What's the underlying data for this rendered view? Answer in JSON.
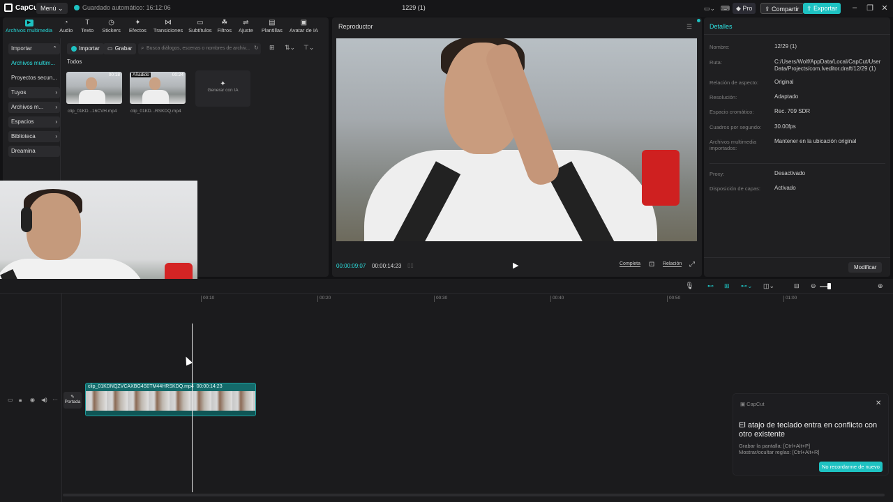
{
  "titlebar": {
    "brand": "CapCut",
    "menu": "Menú",
    "autosave": "Guardado automático: 16:12:06",
    "project_title": "1229 (1)",
    "pro": "Pro",
    "share": "Compartir",
    "export": "Exportar",
    "accent": "#1ec2c2"
  },
  "toolbar": {
    "items": [
      {
        "label": "Archivos multimedia",
        "icon": "media-icon"
      },
      {
        "label": "Audio",
        "icon": "audio-icon"
      },
      {
        "label": "Texto",
        "icon": "text-icon"
      },
      {
        "label": "Stickers",
        "icon": "sticker-icon"
      },
      {
        "label": "Efectos",
        "icon": "effects-icon"
      },
      {
        "label": "Transiciones",
        "icon": "transitions-icon"
      },
      {
        "label": "Subtítulos",
        "icon": "subtitles-icon"
      },
      {
        "label": "Filtros",
        "icon": "filters-icon"
      },
      {
        "label": "Ajuste",
        "icon": "adjust-icon"
      },
      {
        "label": "Plantillas",
        "icon": "templates-icon"
      },
      {
        "label": "Avatar de IA",
        "icon": "avatar-icon"
      }
    ]
  },
  "sidebar": {
    "items": [
      {
        "label": "Importar"
      },
      {
        "label": "Archivos multim..."
      },
      {
        "label": "Proyectos secun..."
      },
      {
        "label": "Tuyos"
      },
      {
        "label": "Archivos m..."
      },
      {
        "label": "Espacios"
      },
      {
        "label": "Biblioteca"
      },
      {
        "label": "Dreamina"
      }
    ]
  },
  "media": {
    "import": "Importar",
    "record": "Grabar",
    "search_placeholder": "Busca diálogos, escenas o nombres de archiv...",
    "section": "Todos",
    "clips": [
      {
        "name": "clip_01KD...16CVH.mp4",
        "duration": "00:18",
        "tag": ""
      },
      {
        "name": "clip_01KD...RSKDQ.mp4",
        "duration": "00:24",
        "tag": "Añadido"
      }
    ],
    "generate_ai": "Generar con IA"
  },
  "player": {
    "title": "Reproductor",
    "current_time": "00:00:09:07",
    "total_time": "00:00:14:23",
    "full": "Completa",
    "ratio": "Relación"
  },
  "details": {
    "title": "Detalles",
    "rows": [
      {
        "label": "Nombre:",
        "value": "12/29 (1)"
      },
      {
        "label": "Ruta:",
        "value": "C:/Users/Wolf/AppData/Local/CapCut/User Data/Projects/com.lveditor.draft/12/29 (1)"
      },
      {
        "label": "Relación de aspecto:",
        "value": "Original"
      },
      {
        "label": "Resolución:",
        "value": "Adaptado"
      },
      {
        "label": "Espacio cromático:",
        "value": "Rec. 709 SDR"
      },
      {
        "label": "Cuadros por segundo:",
        "value": "30.00fps"
      },
      {
        "label": "Archivos multimedia importados:",
        "value": "Mantener en la ubicación original"
      },
      {
        "label": "Proxy:",
        "value": "Desactivado"
      },
      {
        "label": "Disposición de capas:",
        "value": "Activado"
      }
    ],
    "modify": "Modificar"
  },
  "timeline": {
    "ticks": [
      "00:10",
      "00:20",
      "00:30",
      "00:40",
      "00:50",
      "01:00"
    ],
    "clip_label": "clip_01KDNQZVCAXBG4S0TM44HRSKDQ.mp4",
    "clip_duration": "00:00:14:23",
    "cover": "Portada"
  },
  "toast": {
    "brand": "CapCut",
    "title": "El atajo de teclado entra en conflicto con otro existente",
    "line1": "Grabar la pantalla: [Ctrl+Alt+P]",
    "line2": "Mostrar/ocultar reglas: [Ctrl+Alt+R]",
    "button": "No recordarme de nuevo"
  }
}
